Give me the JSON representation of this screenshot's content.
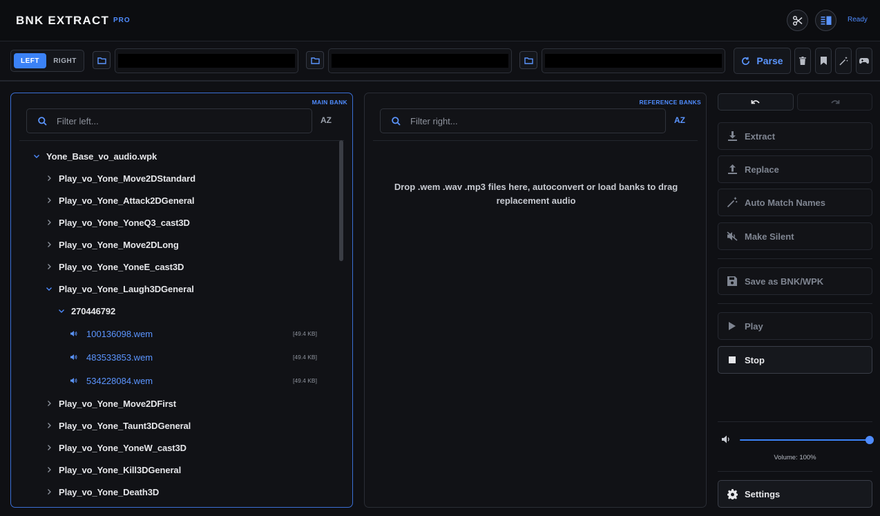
{
  "header": {
    "title": "BNK EXTRACT",
    "badge": "PRO",
    "status": "Ready",
    "buttons": [
      "scissors-icon",
      "columns-icon"
    ]
  },
  "toolbar": {
    "side_left": "LEFT",
    "side_right": "RIGHT",
    "path_1": "",
    "path_2": "",
    "path_3": "",
    "parse_label": "Parse",
    "tools": [
      "trash-icon",
      "bookmark-icon",
      "magic-wand-icon",
      "gamepad-icon"
    ]
  },
  "left_panel": {
    "tag": "MAIN BANK",
    "filter_placeholder": "Filter left...",
    "sort_label": "AZ",
    "tree": [
      {
        "label": "Yone_Base_vo_audio.wpk",
        "level": 0,
        "open": true
      },
      {
        "label": "Play_vo_Yone_Move2DStandard",
        "level": 1,
        "open": false
      },
      {
        "label": "Play_vo_Yone_Attack2DGeneral",
        "level": 1,
        "open": false
      },
      {
        "label": "Play_vo_Yone_YoneQ3_cast3D",
        "level": 1,
        "open": false
      },
      {
        "label": "Play_vo_Yone_Move2DLong",
        "level": 1,
        "open": false
      },
      {
        "label": "Play_vo_Yone_YoneE_cast3D",
        "level": 1,
        "open": false
      },
      {
        "label": "Play_vo_Yone_Laugh3DGeneral",
        "level": 1,
        "open": true
      },
      {
        "label": "270446792",
        "level": 2,
        "open": true
      },
      {
        "label": "100136098.wem",
        "level": 3,
        "file": true,
        "size": "[49.4 KB]"
      },
      {
        "label": "483533853.wem",
        "level": 3,
        "file": true,
        "size": "[49.4 KB]"
      },
      {
        "label": "534228084.wem",
        "level": 3,
        "file": true,
        "size": "[49.4 KB]"
      },
      {
        "label": "Play_vo_Yone_Move2DFirst",
        "level": 1,
        "open": false
      },
      {
        "label": "Play_vo_Yone_Taunt3DGeneral",
        "level": 1,
        "open": false
      },
      {
        "label": "Play_vo_Yone_YoneW_cast3D",
        "level": 1,
        "open": false
      },
      {
        "label": "Play_vo_Yone_Kill3DGeneral",
        "level": 1,
        "open": false
      },
      {
        "label": "Play_vo_Yone_Death3D",
        "level": 1,
        "open": false
      }
    ]
  },
  "right_panel": {
    "tag": "REFERENCE BANKS",
    "filter_placeholder": "Filter right...",
    "sort_label": "AZ",
    "drop_message": "Drop .wem .wav .mp3 files here, autoconvert or load banks to drag replacement audio"
  },
  "actions": {
    "extract": "Extract",
    "replace": "Replace",
    "auto_match": "Auto Match Names",
    "make_silent": "Make Silent",
    "save": "Save as BNK/WPK",
    "play": "Play",
    "stop": "Stop",
    "settings": "Settings"
  },
  "volume": {
    "value": 1.0,
    "label": "Volume: 100%"
  },
  "colors": {
    "accent": "#3b82f6",
    "accent_text": "#5b95ff",
    "background": "#0f1014"
  }
}
